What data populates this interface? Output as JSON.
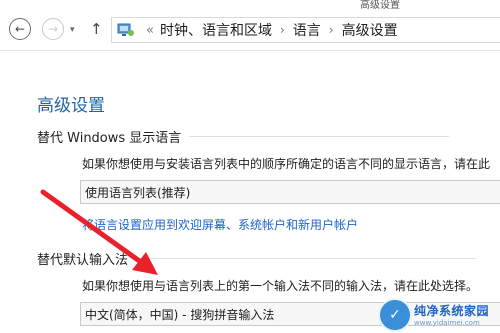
{
  "window": {
    "title": "高级设置"
  },
  "nav": {
    "back_icon": "back-arrow-icon",
    "forward_icon": "forward-arrow-icon",
    "recent_icon": "chevron-down-icon",
    "up_icon": "up-arrow-icon",
    "breadcrumb": {
      "root_sep": "«",
      "item1": "时钟、语言和区域",
      "arrow1": "›",
      "item2": "语言",
      "arrow2": "›",
      "item3": "高级设置"
    }
  },
  "main": {
    "title": "高级设置",
    "display_language": {
      "header": "替代 Windows 显示语言",
      "description": "如果你想使用与安装语言列表中的顺序所确定的语言不同的显示语言，请在此",
      "selected": "使用语言列表(推荐)",
      "link": "将语言设置应用到欢迎屏幕、系统帐户和新用户帐户"
    },
    "input_method": {
      "header": "替代默认输入法",
      "description": "如果你想使用与语言列表上的第一个输入法不同的输入法，请在此处选择。",
      "selected": "中文(简体，中国) - 搜狗拼音输入法"
    }
  },
  "watermark": {
    "text": "纯净系统家园",
    "url": "www.yidaimei.com"
  },
  "colors": {
    "accent_title": "#1e64a0",
    "link": "#1e64c8",
    "annotation_arrow": "#e8212a"
  }
}
